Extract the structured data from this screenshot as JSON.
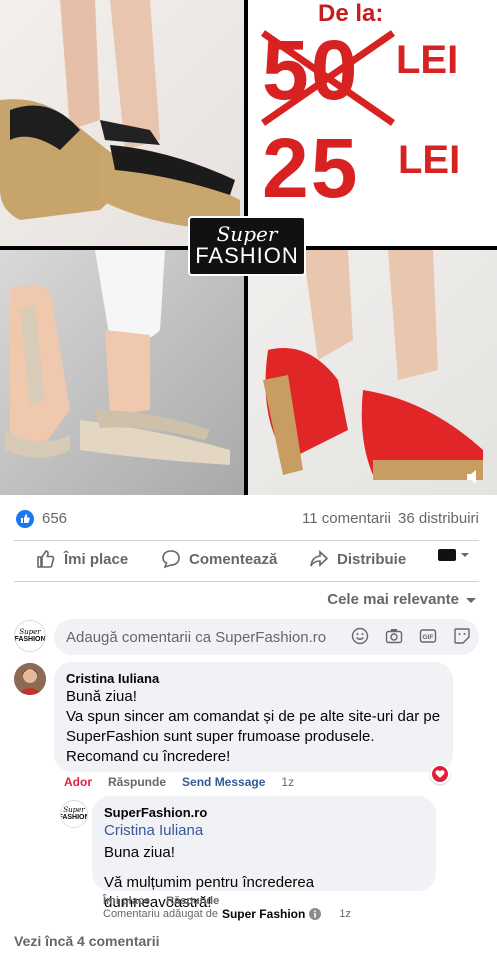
{
  "hero": {
    "price_prefix": "De la:",
    "old_price": "50",
    "old_price_currency": "LEI",
    "new_price": "25",
    "new_price_currency": "LEI",
    "brand_top": "Super",
    "brand_bottom": "FASHION",
    "watermark": "SUPER FASHION"
  },
  "stats": {
    "reactions": "656",
    "comments": "11 comentarii",
    "shares": "36 distribuiri"
  },
  "actions": {
    "like": "Îmi place",
    "comment": "Comentează",
    "share": "Distribuie"
  },
  "sort": {
    "label": "Cele mai relevante"
  },
  "composer": {
    "placeholder": "Adaugă comentarii ca SuperFashion.ro",
    "avatar_top": "Super",
    "avatar_bottom": "FASHION"
  },
  "comment1": {
    "author": "Cristina Iuliana",
    "line1": "Bună ziua!",
    "line2": "Va spun sincer am comandat și de pe alte site-uri dar pe",
    "line3": "SuperFashion sunt super frumoase produsele.",
    "line4": "Recomand cu încredere!",
    "meta_author_tag": "Ador",
    "meta_reply": "Răspunde",
    "meta_send": "Send Message",
    "meta_time": "1z"
  },
  "reply1": {
    "author": "SuperFashion.ro",
    "mention": "Cristina Iuliana",
    "line1": "Buna ziua!",
    "line2": "Vă mulțumim pentru încrederea dumneavoastră!",
    "meta_like": "Îmi place",
    "meta_reply": "Răspunde",
    "added_by_prefix": "Comentariu adăugat de",
    "added_by_name": "Super Fashion",
    "meta_time": "1z"
  },
  "more": {
    "label": "Vezi încă 4 comentarii"
  },
  "colors": {
    "brand_blue": "#1877f2",
    "link_blue": "#385898",
    "heart_red": "#e41e3f",
    "price_red": "#d82222"
  }
}
